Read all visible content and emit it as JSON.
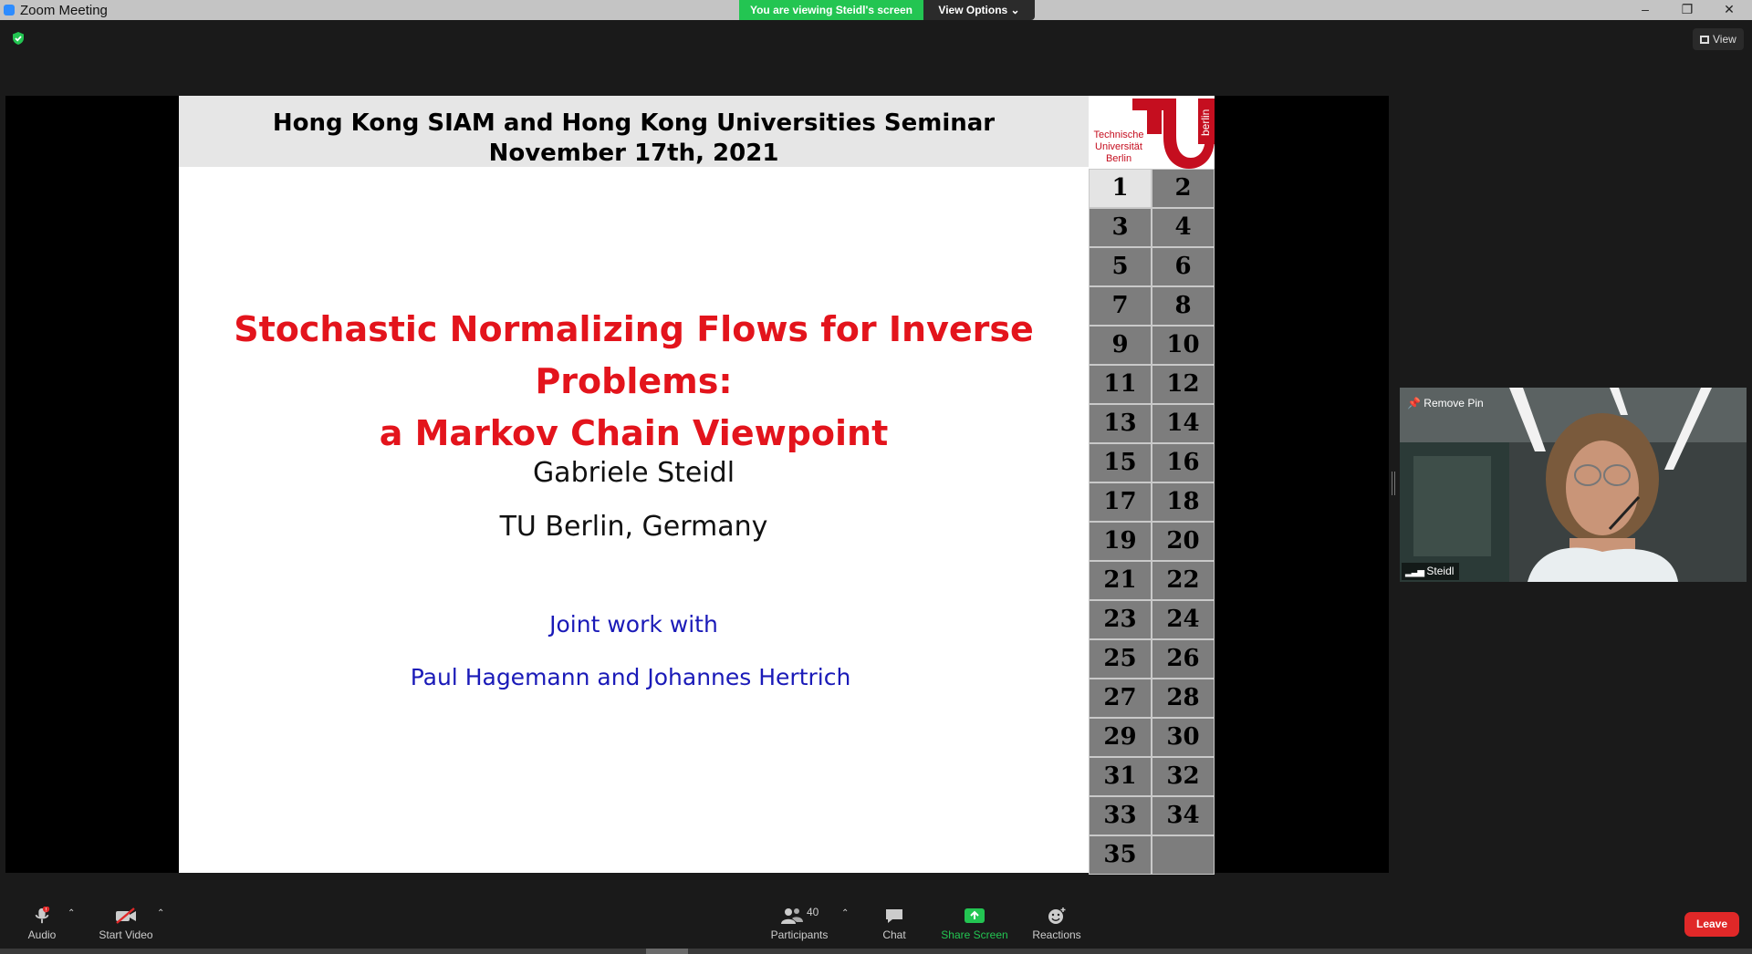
{
  "window": {
    "title": "Zoom Meeting",
    "viewing_banner": "You are viewing Steidl's screen",
    "view_options": "View Options ⌄",
    "minimize": "–",
    "restore": "❐",
    "close": "✕"
  },
  "top_right": {
    "view_label": "View"
  },
  "slide": {
    "header_line1": "Hong Kong SIAM and Hong Kong Universities Seminar",
    "header_line2": "November 17th, 2021",
    "title_line1": "Stochastic Normalizing Flows for Inverse Problems:",
    "title_line2": "a Markov Chain Viewpoint",
    "author": "Gabriele Steidl",
    "affiliation": "TU Berlin, Germany",
    "joint_label": "Joint work with",
    "coauthors": "Paul Hagemann and Johannes Hertrich",
    "logo_text_1": "Technische",
    "logo_text_2": "Universität",
    "logo_text_3": "Berlin",
    "logo_side": "berlin",
    "nav_pages": [
      "1",
      "2",
      "3",
      "4",
      "5",
      "6",
      "7",
      "8",
      "9",
      "10",
      "11",
      "12",
      "13",
      "14",
      "15",
      "16",
      "17",
      "18",
      "19",
      "20",
      "21",
      "22",
      "23",
      "24",
      "25",
      "26",
      "27",
      "28",
      "29",
      "30",
      "31",
      "32",
      "33",
      "34",
      "35",
      ""
    ],
    "active_page": "1"
  },
  "video": {
    "remove_pin": "Remove Pin",
    "participant_name": "Steidl"
  },
  "toolbar": {
    "audio": "Audio",
    "audio_badge": "!",
    "start_video": "Start Video",
    "participants": "Participants",
    "participants_count": "40",
    "chat": "Chat",
    "share_screen": "Share Screen",
    "reactions": "Reactions",
    "leave": "Leave"
  },
  "colors": {
    "share_banner": "#23c552",
    "slide_title": "#e3141c",
    "coauthor_blue": "#1a1ab8",
    "leave_red": "#e02828",
    "tu_red": "#c50e1f"
  }
}
